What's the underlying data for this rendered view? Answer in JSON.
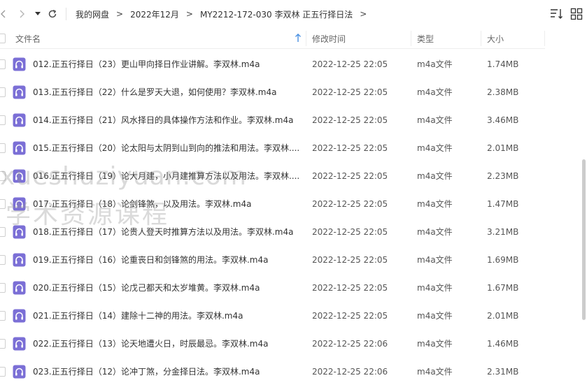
{
  "breadcrumb": [
    "我的网盘",
    "2022年12月",
    "MY2212-172-030 李双林 正五行择日法"
  ],
  "breadcrumb_separator": ">",
  "header": {
    "name": "文件名",
    "modified": "修改时间",
    "type": "类型",
    "size": "大小"
  },
  "files": [
    {
      "name": "012.正五行择日（23）更山甲向择日作业讲解。李双林.m4a",
      "date": "2022-12-25 22:05",
      "type": "m4a文件",
      "size": "1.74MB"
    },
    {
      "name": "013.正五行择日（22）什么是罗天大退，如何使用？李双林.m4a",
      "date": "2022-12-25 22:05",
      "type": "m4a文件",
      "size": "2.38MB"
    },
    {
      "name": "014.正五行择日（21）风水择日的具体操作方法和作业。李双林.m4a",
      "date": "2022-12-25 22:05",
      "type": "m4a文件",
      "size": "3.46MB"
    },
    {
      "name": "015.正五行择日（20）论太阳与太阴到山到向的推法和用法。李双林....",
      "date": "2022-12-25 22:05",
      "type": "m4a文件",
      "size": "2.01MB"
    },
    {
      "name": "016.正五行择日（19）论大月建，小月建推算方法以及用法。李双林....",
      "date": "2022-12-25 22:05",
      "type": "m4a文件",
      "size": "2.23MB"
    },
    {
      "name": "017.正五行择日（18）论剑锋煞，以及用法。李双林.m4a",
      "date": "2022-12-25 22:05",
      "type": "m4a文件",
      "size": "1.47MB"
    },
    {
      "name": "018.正五行择日（17）论贵人登天时推算方法以及用法。李双林.m4a",
      "date": "2022-12-25 22:05",
      "type": "m4a文件",
      "size": "3.21MB"
    },
    {
      "name": "019.正五行择日（16）论重丧日和剑锋煞的用法。李双林.m4a",
      "date": "2022-12-25 22:05",
      "type": "m4a文件",
      "size": "1.69MB"
    },
    {
      "name": "020.正五行择日（15）论戊己都天和太岁堆黄。李双林.m4a",
      "date": "2022-12-25 22:05",
      "type": "m4a文件",
      "size": "1.67MB"
    },
    {
      "name": "021.正五行择日（14）建除十二神的用法。李双林.m4a",
      "date": "2022-12-25 22:05",
      "type": "m4a文件",
      "size": "2.01MB"
    },
    {
      "name": "022.正五行择日（13）论天地遭火日，时辰最忌。李双林.m4a",
      "date": "2022-12-25 22:06",
      "type": "m4a文件",
      "size": "1.46MB"
    },
    {
      "name": "023.正五行择日（12）论冲丁煞，分金择日法。李双林.m4a",
      "date": "2022-12-25 22:06",
      "type": "m4a文件",
      "size": "2.31MB"
    }
  ],
  "watermark": {
    "line1": "xueshuziyuan.com",
    "line2": "学术资源课程"
  },
  "colors": {
    "file_icon": "#7b6fd6",
    "sort_arrow": "#4a90e2"
  },
  "icons": {
    "back": "chevron-left",
    "forward": "chevron-right",
    "history": "caret-down",
    "refresh": "refresh",
    "sort": "sort-lines",
    "view": "grid"
  }
}
